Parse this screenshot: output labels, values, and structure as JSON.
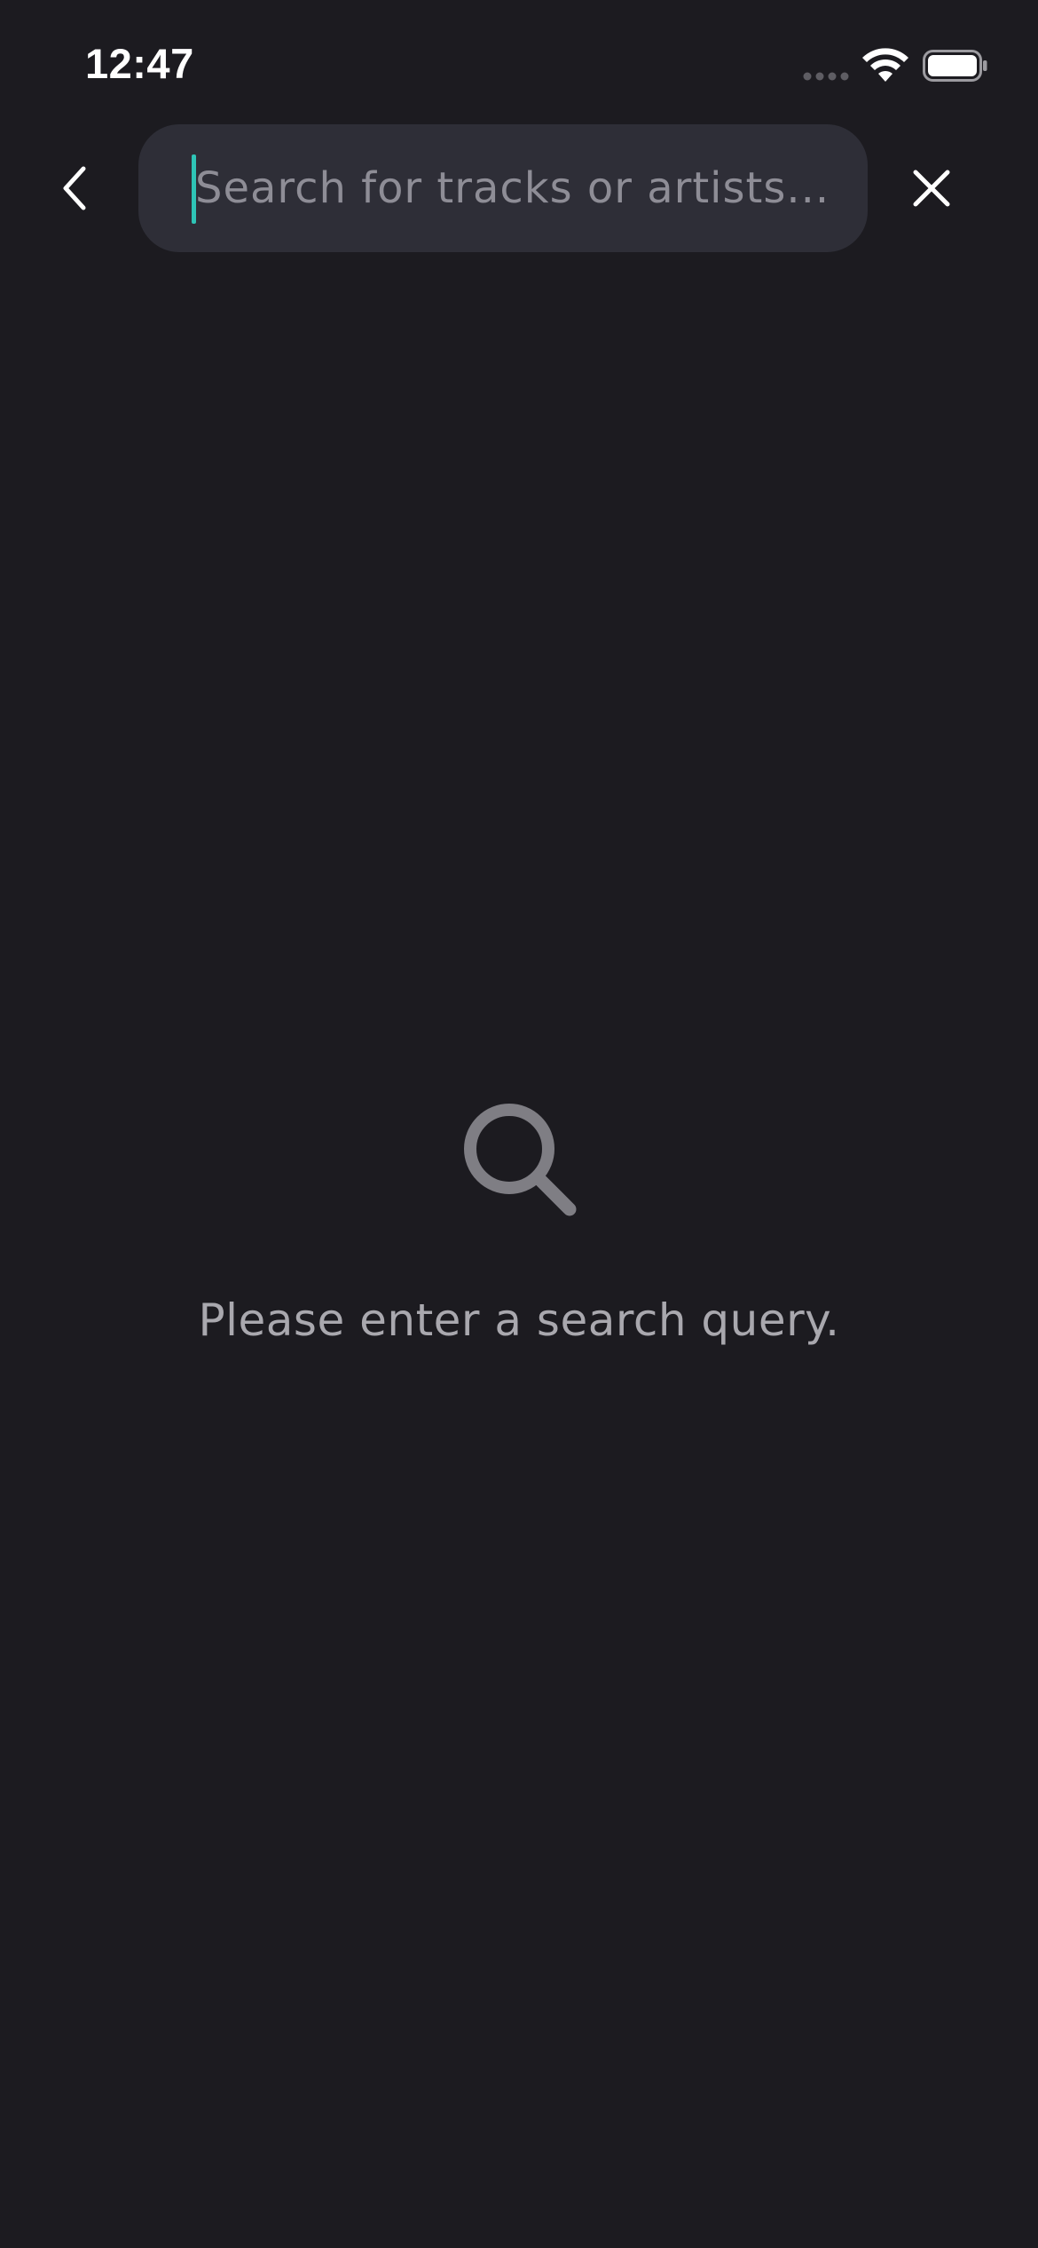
{
  "status_bar": {
    "time": "12:47",
    "icons": [
      "signal-dots-icon",
      "wifi-icon",
      "battery-icon"
    ]
  },
  "header": {
    "back_icon": "chevron-left-icon",
    "search": {
      "value": "",
      "placeholder": "Search for tracks or artists..."
    },
    "clear_icon": "close-icon"
  },
  "empty_state": {
    "icon": "search-icon",
    "message": "Please enter a search query."
  },
  "colors": {
    "background": "#1c1b20",
    "search_field": "#2e2e37",
    "placeholder": "#8e8d96",
    "accent": "#2ec4b6",
    "muted_text": "#a9a8ae",
    "empty_icon": "#7f7e84"
  }
}
